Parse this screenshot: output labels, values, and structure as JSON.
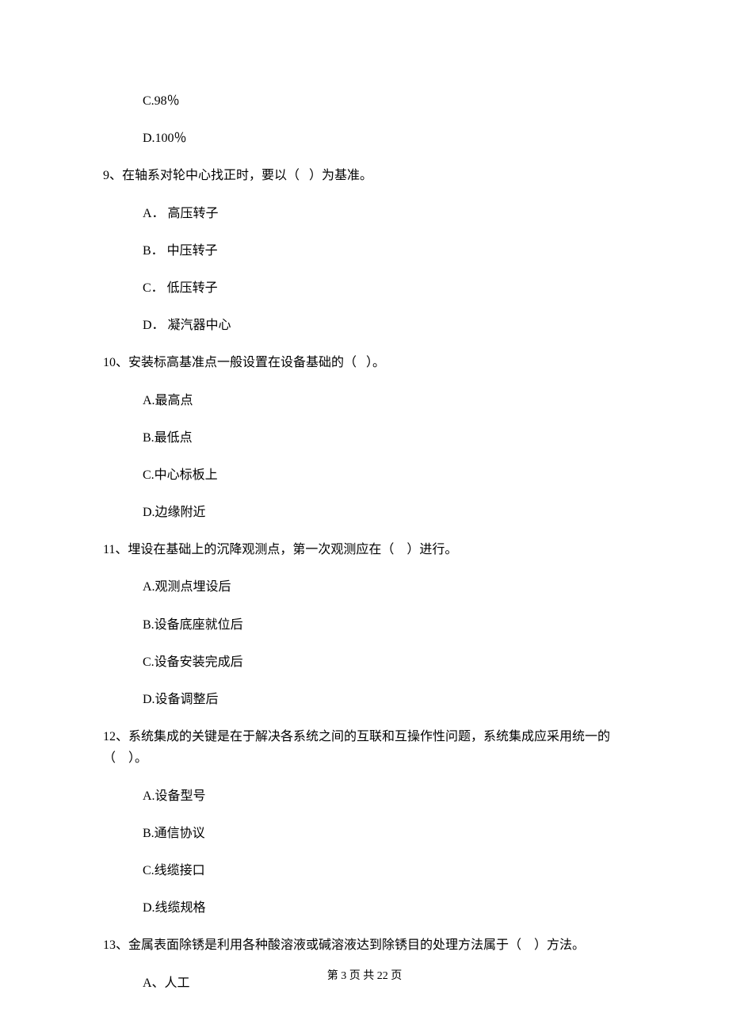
{
  "q8": {
    "optC": "C.98％",
    "optD": "D.100％"
  },
  "q9": {
    "stem": "9、在轴系对轮中心找正时，要以（   ）为基准。",
    "optA": "A． 高压转子",
    "optB": "B． 中压转子",
    "optC": "C． 低压转子",
    "optD": "D． 凝汽器中心"
  },
  "q10": {
    "stem": "10、安装标高基准点一般设置在设备基础的（   ）。",
    "optA": "A.最高点",
    "optB": "B.最低点",
    "optC": "C.中心标板上",
    "optD": "D.边缘附近"
  },
  "q11": {
    "stem": "11、埋设在基础上的沉降观测点，第一次观测应在（    ）进行。",
    "optA": "A.观测点埋设后",
    "optB": "B.设备底座就位后",
    "optC": "C.设备安装完成后",
    "optD": "D.设备调整后"
  },
  "q12": {
    "stem1": "12、系统集成的关键是在于解决各系统之间的互联和互操作性问题，系统集成应采用统一的",
    "stem2": "（    ）。",
    "optA": "A.设备型号",
    "optB": "B.通信协议",
    "optC": "C.线缆接口",
    "optD": "D.线缆规格"
  },
  "q13": {
    "stem": "13、金属表面除锈是利用各种酸溶液或碱溶液达到除锈目的处理方法属于（    ）方法。",
    "optA": "A、人工"
  },
  "footer": "第 3 页 共 22 页"
}
